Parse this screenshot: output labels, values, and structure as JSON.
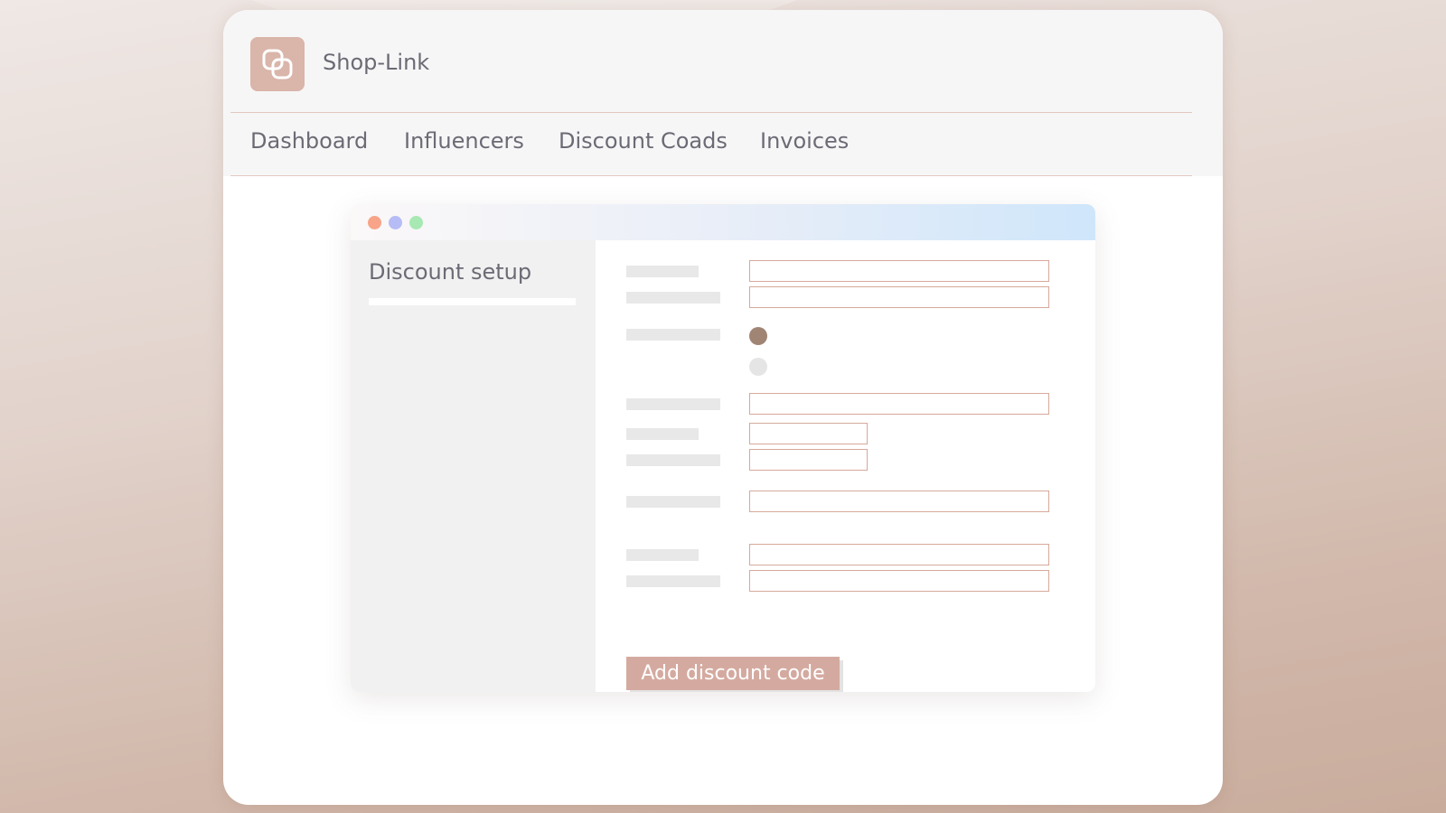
{
  "app": {
    "name": "Shop-Link",
    "logo_icon": "overlapping-squares-icon"
  },
  "nav": {
    "items": [
      {
        "label": "Dashboard"
      },
      {
        "label": "Influencers"
      },
      {
        "label": "Discount Coads"
      },
      {
        "label": "Invoices"
      }
    ]
  },
  "inner_window": {
    "window_controls": [
      "close-dot",
      "minimize-dot",
      "maximize-dot"
    ],
    "sidebar": {
      "title": "Discount setup"
    },
    "form": {
      "selected_option_index": 0,
      "button_label": "Add discount code"
    }
  },
  "colors": {
    "accent": "#d4aaa0",
    "field_border": "#d6a99b",
    "radio_selected": "#a08474",
    "dot_red": "#f7a489",
    "dot_blue": "#b6bcf5",
    "dot_green": "#a7e8b3"
  }
}
